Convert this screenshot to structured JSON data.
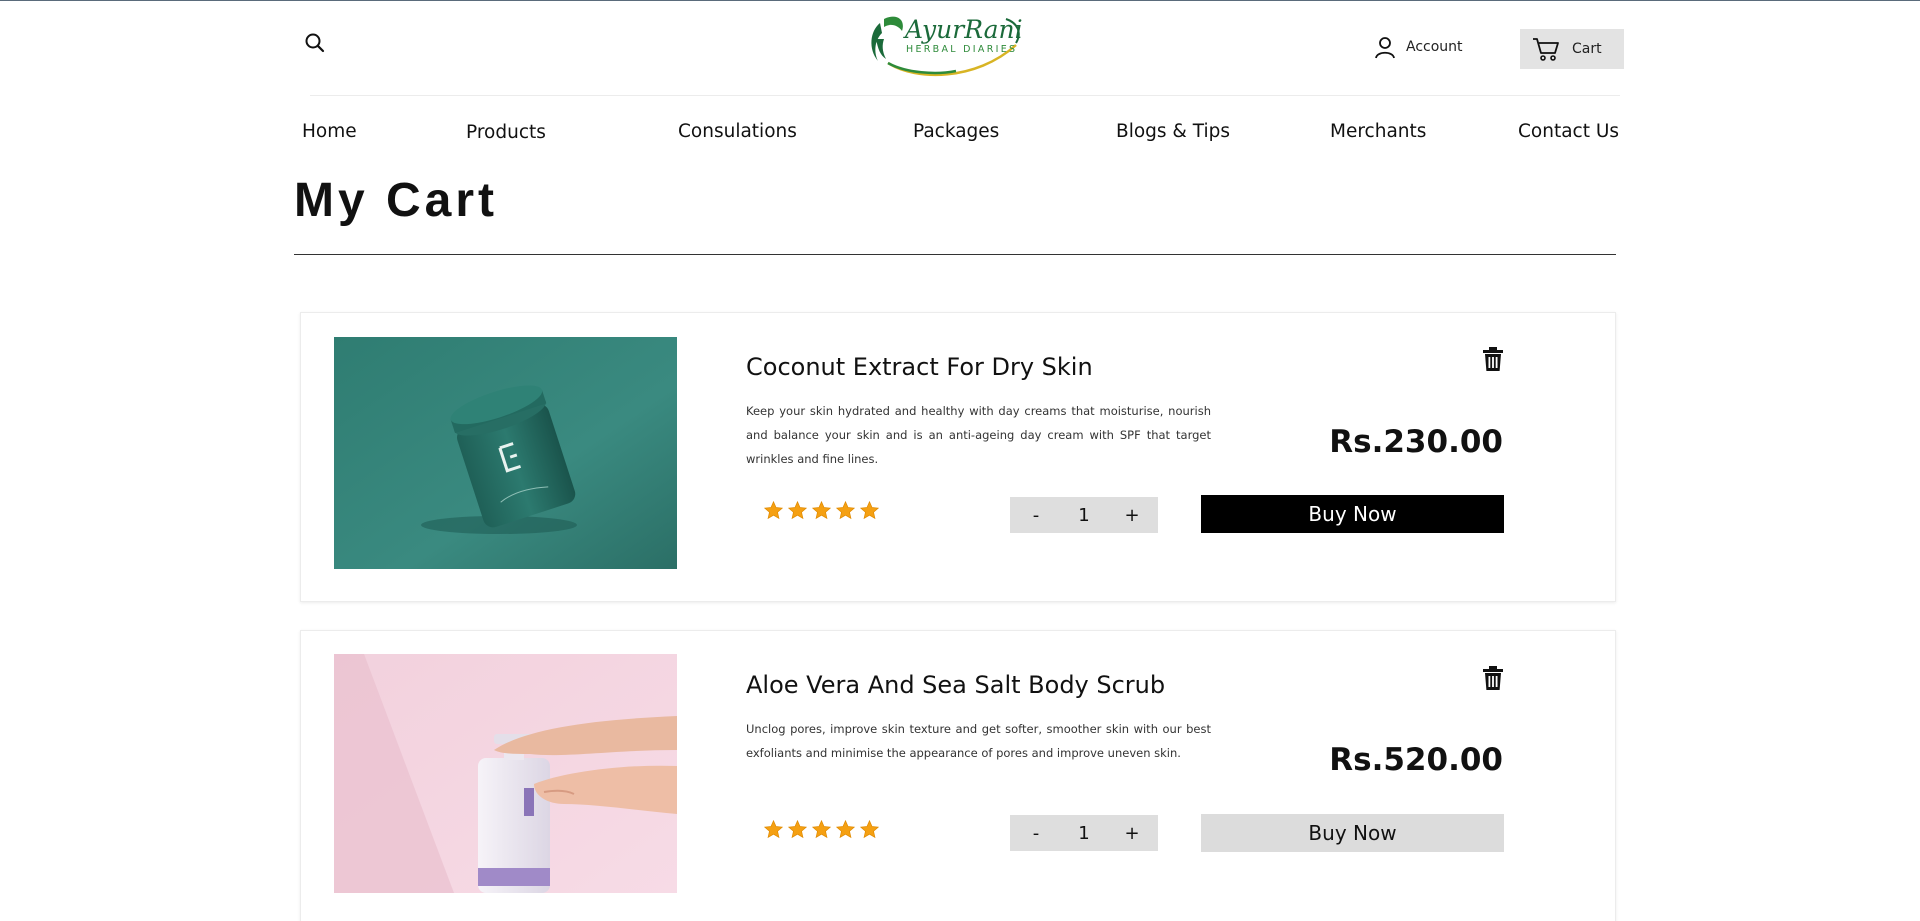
{
  "header": {
    "logo": {
      "name": "AyurRani",
      "tagline": "HERBAL DIARIES"
    },
    "search_icon": "search-icon",
    "account_label": "Account",
    "cart_label": "Cart"
  },
  "nav": {
    "items": [
      {
        "label": "Home"
      },
      {
        "label": "Products"
      },
      {
        "label": "Consulations"
      },
      {
        "label": "Packages"
      },
      {
        "label": "Blogs & Tips"
      },
      {
        "label": "Merchants"
      },
      {
        "label": "Contact Us"
      }
    ]
  },
  "page": {
    "title": "My Cart"
  },
  "cart": {
    "items": [
      {
        "name": "Coconut Extract For Dry Skin",
        "description": "Keep your skin hydrated and healthy with day creams that moisturise, nourish and balance your skin and is an anti-ageing day cream with SPF that target wrinkles and fine lines.",
        "price": "Rs.230.00",
        "rating": 5,
        "quantity": "1",
        "minus_label": "-",
        "plus_label": "+",
        "buy_label": "Buy Now",
        "image_icon": "teal-cream-jar-photo"
      },
      {
        "name": "Aloe Vera And Sea Salt Body Scrub",
        "description": "Unclog pores, improve skin texture and get softer, smoother skin with our best exfoliants and minimise the appearance of pores and improve uneven skin.",
        "price": "Rs.520.00",
        "rating": 5,
        "quantity": "1",
        "minus_label": "-",
        "plus_label": "+",
        "buy_label": "Buy Now",
        "image_icon": "pump-bottle-hands-photo"
      }
    ]
  },
  "colors": {
    "star": "#f5a012",
    "buy_primary_bg": "#000000",
    "buy_secondary_bg": "#dcdcdc",
    "cart_button_bg": "#e3e3e3",
    "qty_bg": "#dedede",
    "logo_green": "#1b6a3a",
    "logo_gold": "#d8b424"
  }
}
